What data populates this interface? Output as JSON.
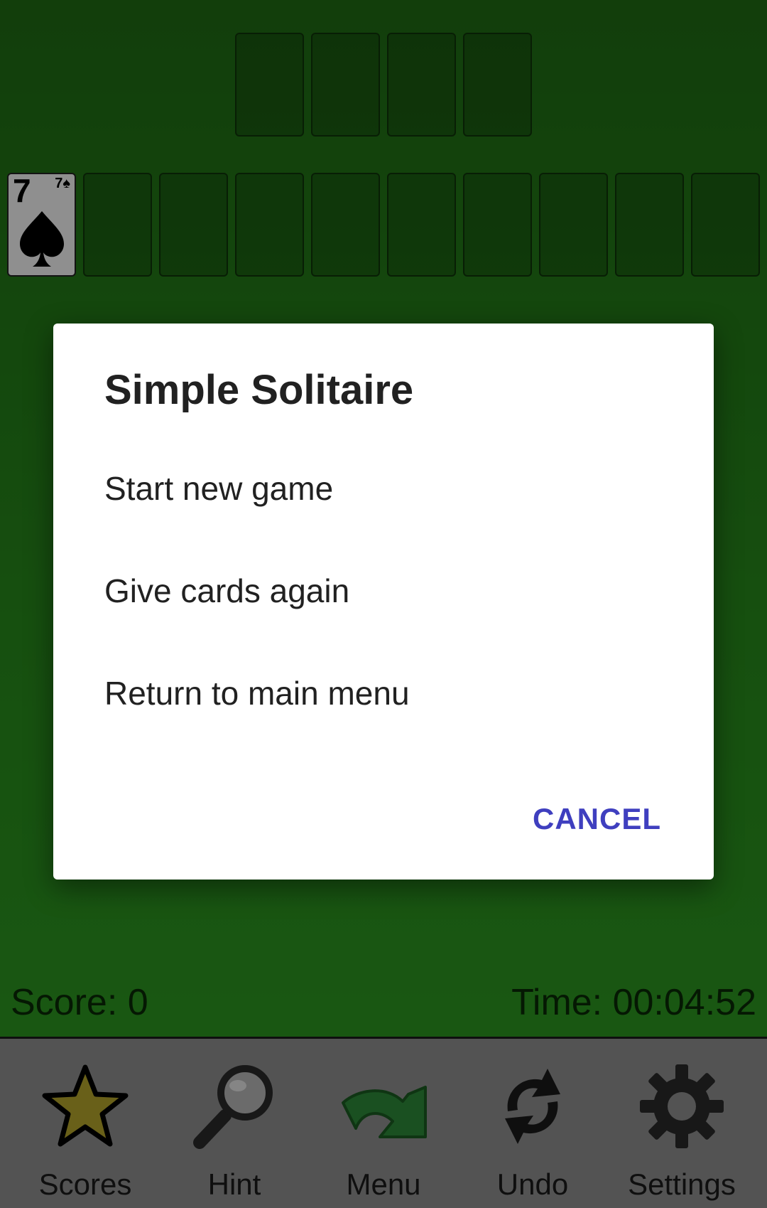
{
  "foundation_slots": 4,
  "tableau": {
    "slots": 10,
    "first_card": {
      "rank": "7",
      "suit": "spade",
      "corner_text": "7♠"
    }
  },
  "status": {
    "score_text": "Score: 0",
    "time_text": "Time: 00:04:52"
  },
  "toolbar": {
    "items": [
      {
        "label": "Scores",
        "icon": "star-icon"
      },
      {
        "label": "Hint",
        "icon": "magnifier-icon"
      },
      {
        "label": "Menu",
        "icon": "arrow-icon"
      },
      {
        "label": "Undo",
        "icon": "refresh-icon"
      },
      {
        "label": "Settings",
        "icon": "gear-icon"
      }
    ]
  },
  "dialog": {
    "title": "Simple Solitaire",
    "items": [
      "Start new game",
      "Give cards again",
      "Return to main menu"
    ],
    "cancel_label": "CANCEL"
  },
  "colors": {
    "table_green": "#2c8a1f",
    "dialog_accent": "#3f3fbf",
    "toolbar_bg": "#8f8f8f"
  }
}
